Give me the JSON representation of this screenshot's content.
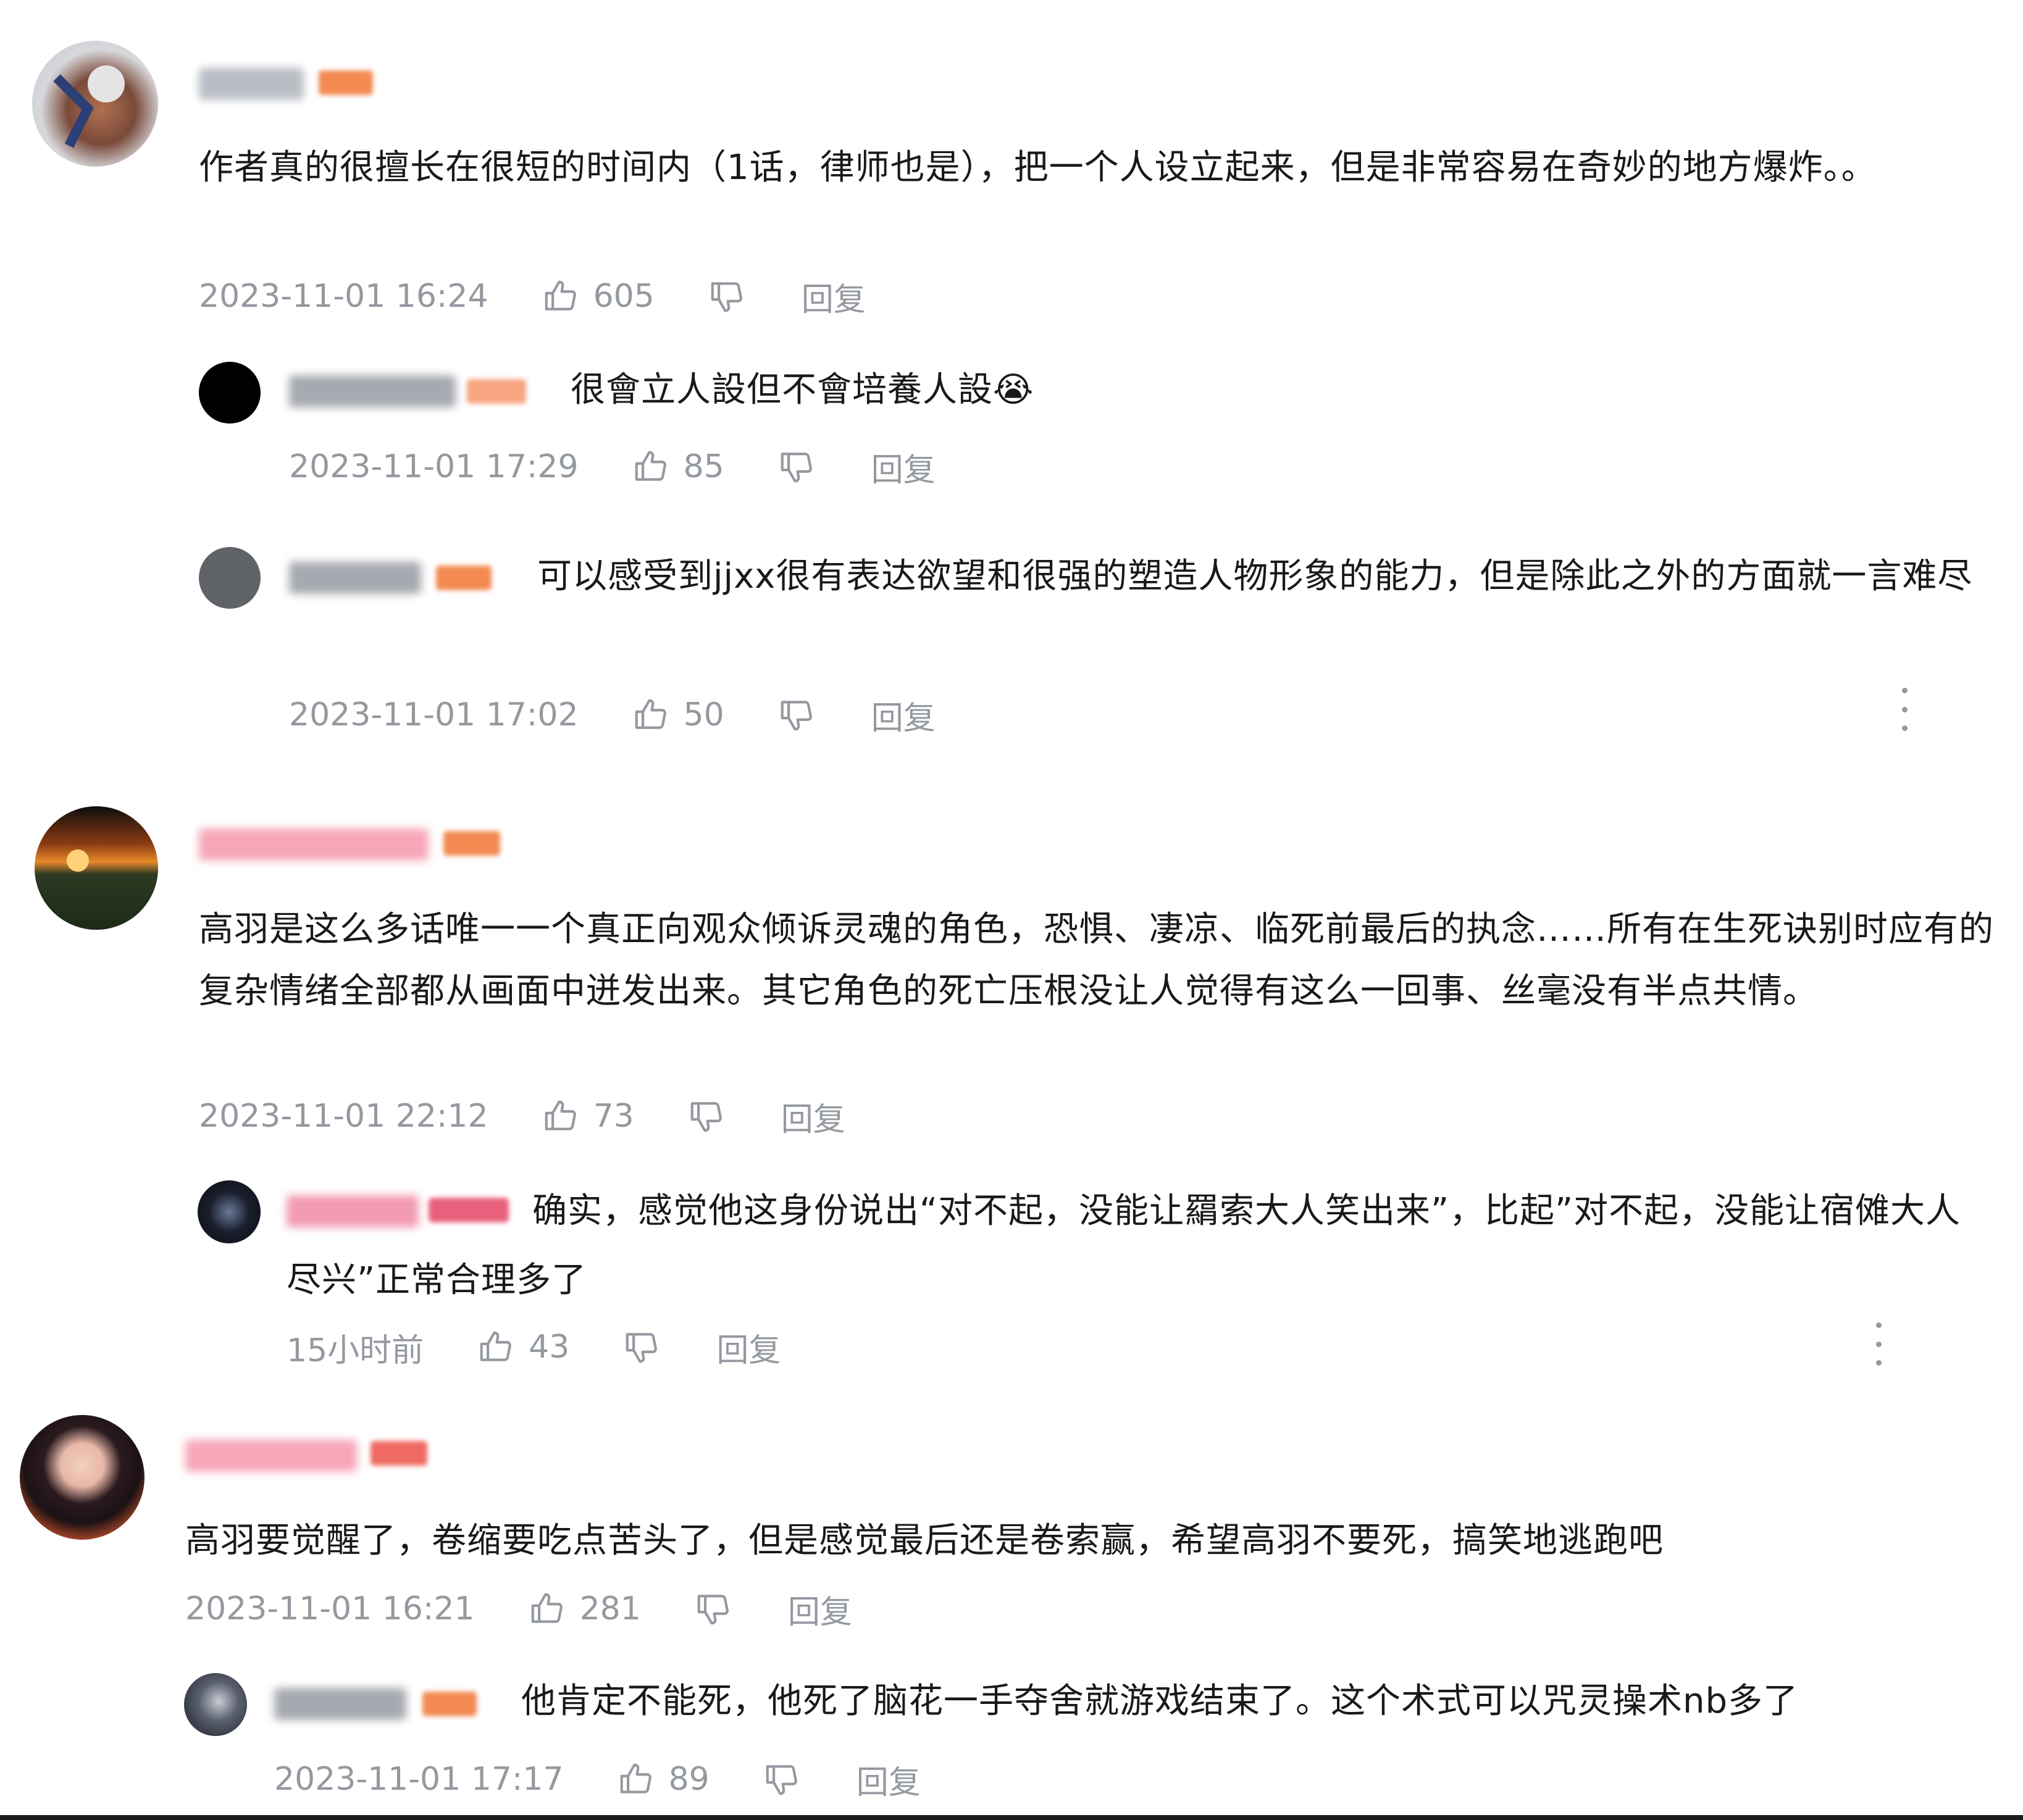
{
  "comments": [
    {
      "user": "paoldo",
      "text": "作者真的很擅长在很短的时间内（1话，律师也是），把一个人设立起来，但是非常容易在奇妙的地方爆炸。。",
      "time": "2023-11-01 16:24",
      "likes": "605",
      "reply_label": "回复",
      "replies": [
        {
          "user": "",
          "text": "很會立人設但不會培養人設😭",
          "time": "2023-11-01 17:29",
          "likes": "85",
          "reply_label": "回复"
        },
        {
          "user": "",
          "text": "可以感受到jjxx很有表达欲望和很强的塑造人物形象的能力，但是除此之外的方面就一言难尽",
          "time": "2023-11-01 17:02",
          "likes": "50",
          "reply_label": "回复"
        }
      ]
    },
    {
      "user": "",
      "text": "高羽是这么多话唯一一个真正向观众倾诉灵魂的角色，恐惧、凄凉、临死前最后的执念……所有在生死诀别时应有的复杂情绪全部都从画面中迸发出来。其它角色的死亡压根没让人觉得有这么一回事、丝毫没有半点共情。",
      "time": "2023-11-01 22:12",
      "likes": "73",
      "reply_label": "回复",
      "replies": [
        {
          "user": "",
          "text": "确实，感觉他这身份说出“对不起，没能让羂索大人笑出来”，比起”对不起，没能让宿傩大人尽兴”正常合理多了",
          "time": "15小时前",
          "likes": "43",
          "reply_label": "回复"
        }
      ]
    },
    {
      "user": "",
      "text": "高羽要觉醒了，卷缩要吃点苦头了，但是感觉最后还是卷索赢，希望高羽不要死，搞笑地逃跑吧",
      "time": "2023-11-01 16:21",
      "likes": "281",
      "reply_label": "回复",
      "replies": [
        {
          "user": "",
          "text": "他肯定不能死，他死了脑花一手夺舍就游戏结束了。这个术式可以咒灵操术nb多了",
          "time": "2023-11-01 17:17",
          "likes": "89",
          "reply_label": "回复"
        }
      ]
    }
  ],
  "colors": {
    "meta": "#9499a0",
    "text": "#18191c",
    "badge": "#f28a52",
    "pink_name": "#f7a6b8"
  },
  "icons": [
    "thumbs-up-icon",
    "thumbs-down-icon",
    "more-vertical-icon"
  ]
}
